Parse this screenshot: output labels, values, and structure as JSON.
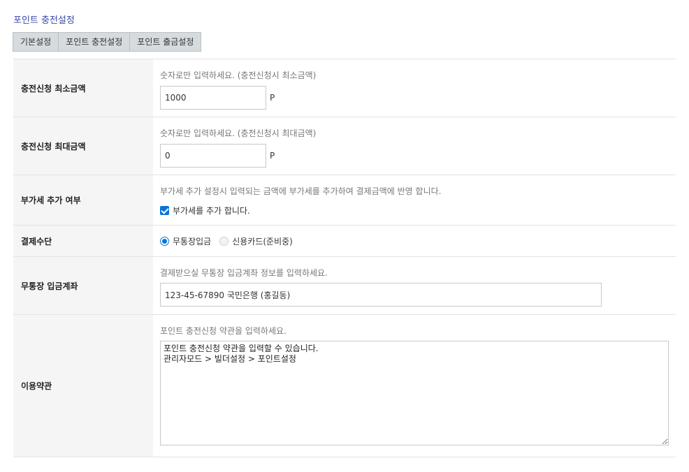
{
  "page": {
    "title": "포인트 충전설정"
  },
  "tabs": [
    {
      "label": "기본설정"
    },
    {
      "label": "포인트 충전설정"
    },
    {
      "label": "포인트 출금설정"
    }
  ],
  "min_amount": {
    "label": "충전신청 최소금액",
    "hint": "숫자로만 입력하세요. (충전신청시 최소금액)",
    "value": "1000",
    "unit": "P"
  },
  "max_amount": {
    "label": "충전신청 최대금액",
    "hint": "숫자로만 입력하세요. (충전신청시 최대금액)",
    "value": "0",
    "unit": "P"
  },
  "vat": {
    "label": "부가세 추가 여부",
    "hint": "부가세 추가 설정시 입력되는 금액에 부가세를 추가하여 결제금액에 반영 합니다.",
    "checkbox_label": "부가세를 추가 합니다.",
    "checked": true
  },
  "payment_method": {
    "label": "결제수단",
    "options": [
      {
        "label": "무통장입금",
        "selected": true,
        "disabled": false
      },
      {
        "label": "신용카드(준비중)",
        "selected": false,
        "disabled": true
      }
    ]
  },
  "bank_account": {
    "label": "무통장 입금계좌",
    "hint": "결제받으실 무통장 입금계좌 정보를 입력하세요.",
    "value": "123-45-67890 국민은행 (홍길동)"
  },
  "terms": {
    "label": "이용약관",
    "hint": "포인트 충전신청 약관을 입력하세요.",
    "value": "포인트 충전신청 약관을 입력할 수 있습니다.\n관리자모드 > 빌더설정 > 포인트설정"
  },
  "colors": {
    "title": "#3a4aa8",
    "tab_bg": "#d6dbde",
    "label_bg": "#f5f5f5",
    "accent": "#0a74d8"
  }
}
